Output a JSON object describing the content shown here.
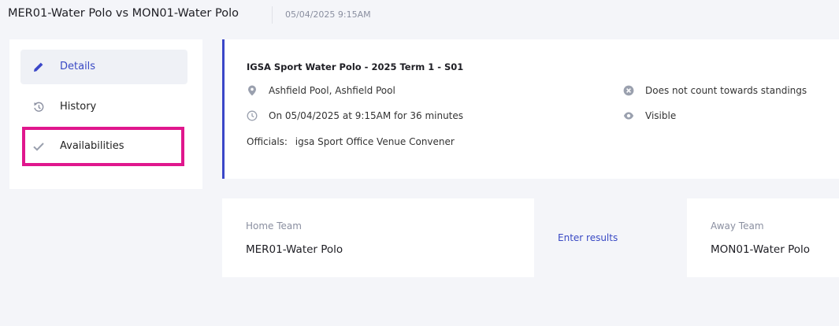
{
  "header": {
    "title": "MER01-Water Polo vs MON01-Water Polo",
    "datetime": "05/04/2025 9:15AM"
  },
  "sidebar": {
    "items": [
      {
        "label": "Details",
        "icon": "pencil-icon",
        "active": true
      },
      {
        "label": "History",
        "icon": "history-icon",
        "active": false
      },
      {
        "label": "Availabilities",
        "icon": "check-icon",
        "active": false
      }
    ]
  },
  "info": {
    "league": "IGSA Sport Water Polo - 2025 Term 1 - S01",
    "venue": "Ashfield Pool, Ashfield Pool",
    "schedule": "On 05/04/2025 at 9:15AM for 36 minutes",
    "officials_label": "Officials:",
    "officials_value": "igsa Sport Office Venue Convener",
    "standings": "Does not count towards standings",
    "visibility": "Visible"
  },
  "home": {
    "label": "Home Team",
    "name": "MER01-Water Polo"
  },
  "away": {
    "label": "Away Team",
    "name": "MON01-Water Polo"
  },
  "actions": {
    "enter_results": "Enter results"
  },
  "colors": {
    "accent": "#3b47c8",
    "highlight": "#e0178d",
    "background": "#f4f5f9"
  }
}
